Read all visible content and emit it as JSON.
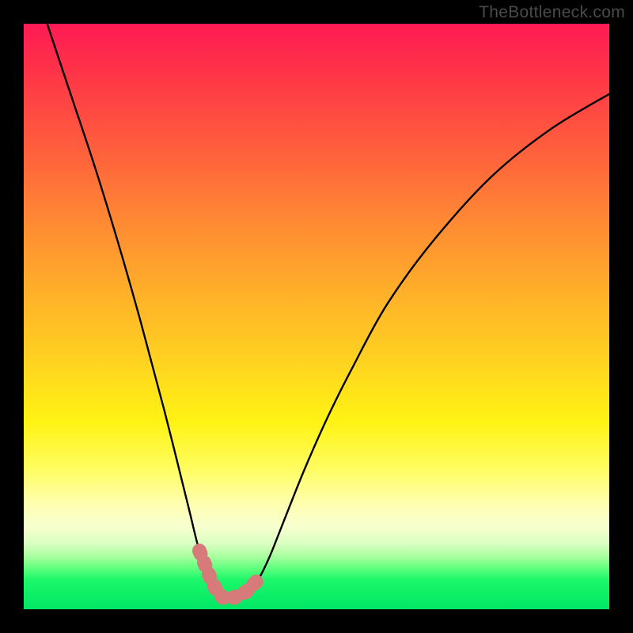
{
  "watermark": "TheBottleneck.com",
  "chart_data": {
    "type": "line",
    "title": "",
    "xlabel": "",
    "ylabel": "",
    "xlim": [
      0,
      100
    ],
    "ylim": [
      0,
      100
    ],
    "grid": false,
    "legend": false,
    "series": [
      {
        "name": "bottleneck-curve",
        "x": [
          4,
          8,
          12,
          16,
          20,
          24,
          28,
          30,
          32,
          33,
          34,
          36,
          38,
          40,
          42,
          44,
          48,
          52,
          56,
          62,
          70,
          80,
          90,
          100
        ],
        "y": [
          100,
          88,
          76,
          63,
          49,
          34,
          18,
          10,
          5,
          3,
          2,
          2,
          3,
          5,
          9,
          14,
          24,
          33,
          41,
          52,
          63,
          74,
          82,
          88
        ]
      }
    ],
    "highlight": {
      "name": "optimal-zone",
      "color": "#d77a7a",
      "x_range": [
        30,
        40
      ],
      "y_range": [
        0,
        10
      ]
    },
    "background_gradient": {
      "orientation": "vertical",
      "stops": [
        {
          "pos": 0.0,
          "color": "#ff1a54"
        },
        {
          "pos": 0.34,
          "color": "#ff8a33"
        },
        {
          "pos": 0.68,
          "color": "#fff314"
        },
        {
          "pos": 0.88,
          "color": "#f7ffd0"
        },
        {
          "pos": 1.0,
          "color": "#00e765"
        }
      ]
    }
  }
}
